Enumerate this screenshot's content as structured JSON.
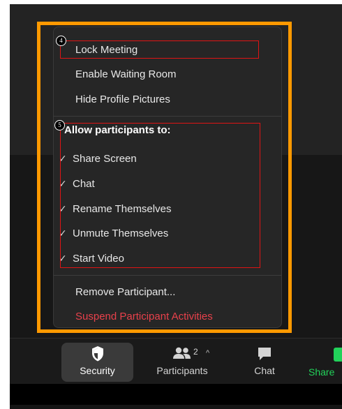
{
  "security_menu": {
    "lock_meeting": "Lock Meeting",
    "enable_waiting_room": "Enable Waiting Room",
    "hide_profile_pictures": "Hide Profile Pictures",
    "allow_header": "Allow participants to:",
    "check_mark": "✓",
    "permissions": [
      {
        "label": "Share Screen",
        "checked": true
      },
      {
        "label": "Chat",
        "checked": true
      },
      {
        "label": "Rename Themselves",
        "checked": true
      },
      {
        "label": "Unmute Themselves",
        "checked": true
      },
      {
        "label": "Start Video",
        "checked": true
      }
    ],
    "remove_participant": "Remove Participant...",
    "suspend_activities": "Suspend Participant Activities"
  },
  "annotations": {
    "badge_4": "4",
    "badge_5": "5"
  },
  "toolbar": {
    "security_label": "Security",
    "participants_label": "Participants",
    "participants_count": "2",
    "caret": "^",
    "chat_label": "Chat",
    "share_label": "Share"
  },
  "colors": {
    "highlight_frame": "#ff9900",
    "annotation_red": "#e01414",
    "danger_text": "#e8414b",
    "share_green": "#22d25a"
  }
}
